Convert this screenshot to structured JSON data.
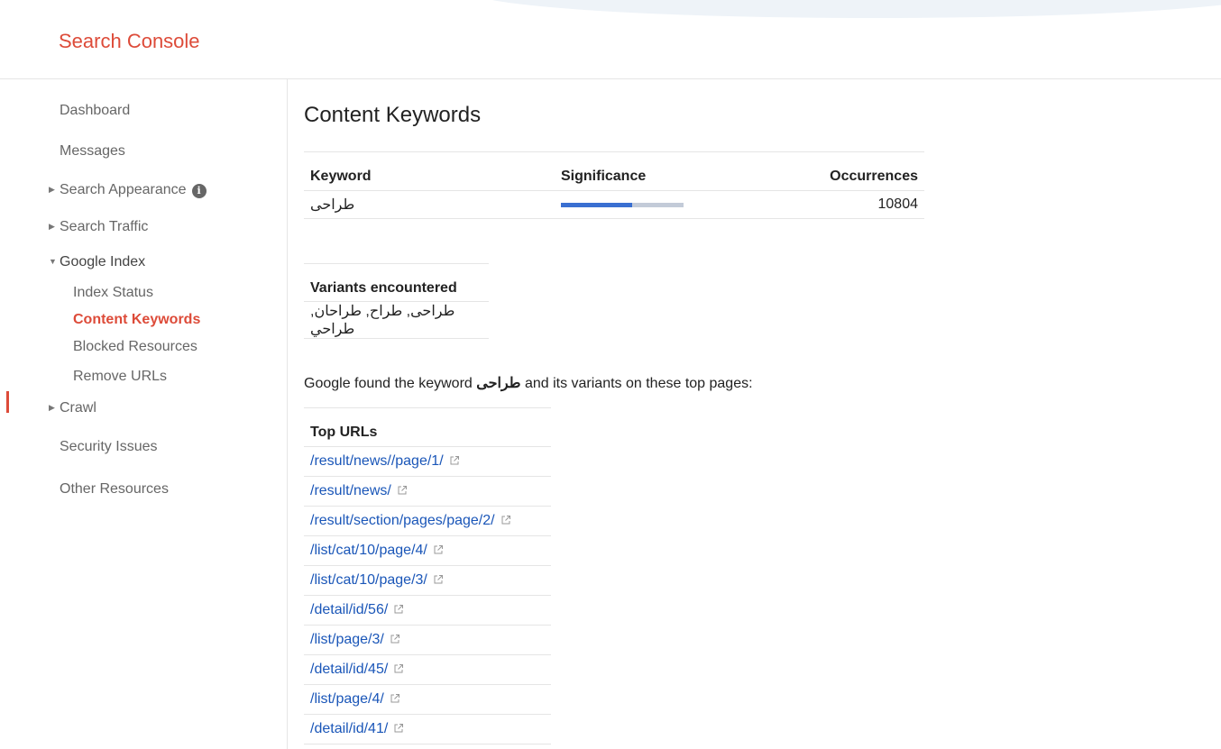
{
  "brand": "Search Console",
  "sidebar": {
    "items": [
      {
        "label": "Dashboard"
      },
      {
        "label": "Messages"
      },
      {
        "label": "Search Appearance"
      },
      {
        "label": "Search Traffic"
      },
      {
        "label": "Google Index"
      },
      {
        "label": "Crawl"
      },
      {
        "label": "Security Issues"
      },
      {
        "label": "Other Resources"
      }
    ],
    "google_index_children": [
      {
        "label": "Index Status"
      },
      {
        "label": "Content Keywords",
        "active": true
      },
      {
        "label": "Blocked Resources"
      },
      {
        "label": "Remove URLs"
      }
    ]
  },
  "main": {
    "title": "Content Keywords",
    "keyword_table": {
      "headers": [
        "Keyword",
        "Significance",
        "Occurrences"
      ],
      "row": {
        "keyword": "طراحی",
        "significance_fraction": 0.58,
        "occurrences": "10804"
      }
    },
    "variants": {
      "header": "Variants encountered",
      "value": "طراحی, طراح, طراحان, طراحي"
    },
    "found": {
      "prefix": "Google found the keyword",
      "keyword": "طراحی",
      "suffix": "and its variants on these top pages:"
    },
    "top_urls": {
      "header": "Top URLs",
      "items": [
        "/result/news//page/1/",
        "/result/news/",
        "/result/section/pages/page/2/",
        "/list/cat/10/page/4/",
        "/list/cat/10/page/3/",
        "/detail/id/56/",
        "/list/page/3/",
        "/detail/id/45/",
        "/list/page/4/",
        "/detail/id/41/"
      ]
    }
  },
  "colors": {
    "brand": "#dd4b39",
    "link": "#1a56b8",
    "significance_fill": "#3a6fd1",
    "significance_track": "#c3cbd8"
  }
}
